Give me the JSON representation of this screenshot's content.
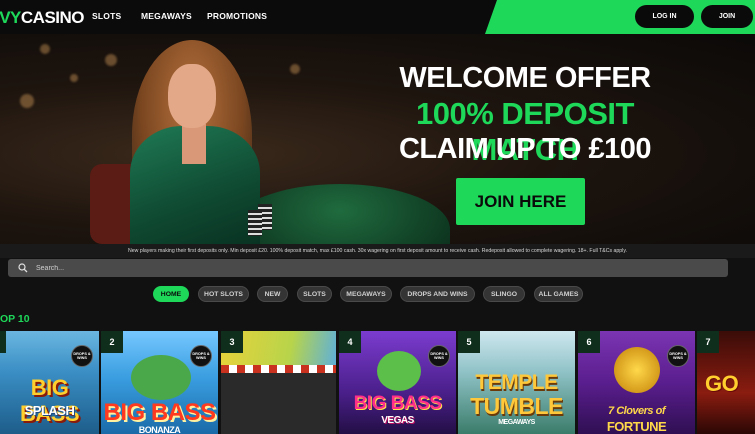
{
  "brand": {
    "logo_prefix": "IVY",
    "logo_suffix": "CASINO",
    "accent": "#1ed85a"
  },
  "nav": {
    "slots": "SLOTS",
    "megaways": "MEGAWAYS",
    "promotions": "PROMOTIONS"
  },
  "header": {
    "login": "LOG IN",
    "join": "JOIN"
  },
  "hero": {
    "line1": "WELCOME OFFER",
    "line2": "100% DEPOSIT MATCH",
    "line3": "CLAIM UP TO £100",
    "cta": "JOIN HERE",
    "terms": "New players making their first deposits only. Min deposit £20. 100% deposit match, max £100 cash. 30x wagering on first deposit amount to receive cash. Redeposit allowed to complete wagering. 18+. Full T&Cs apply."
  },
  "search": {
    "placeholder": "Search...",
    "value": "",
    "icon": "search-icon"
  },
  "filters": [
    "HOME",
    "HOT SLOTS",
    "NEW",
    "SLOTS",
    "MEGAWAYS",
    "DROPS AND WINS",
    "SLINGO",
    "ALL GAMES"
  ],
  "active_filter": "HOME",
  "section": {
    "title": "OP 10"
  },
  "games": [
    {
      "rank": "",
      "title": "BIG BASS",
      "subtitle": "SPLASH",
      "badge": "DROPS & WINS"
    },
    {
      "rank": "2",
      "title": "BIG BASS",
      "subtitle": "BONANZA",
      "badge": "DROPS & WINS"
    },
    {
      "rank": "3",
      "title": "",
      "subtitle": "",
      "badge": ""
    },
    {
      "rank": "4",
      "title": "BIG BASS",
      "subtitle": "VEGAS",
      "badge": "DROPS & WINS"
    },
    {
      "rank": "5",
      "title": "TEMPLE",
      "subtitle": "TUMBLE",
      "extra": "MEGAWAYS",
      "badge": ""
    },
    {
      "rank": "6",
      "title": "7 Clovers of",
      "subtitle": "FORTUNE",
      "badge": "DROPS & WINS"
    },
    {
      "rank": "7",
      "title": "GO",
      "subtitle": "",
      "badge": ""
    }
  ]
}
